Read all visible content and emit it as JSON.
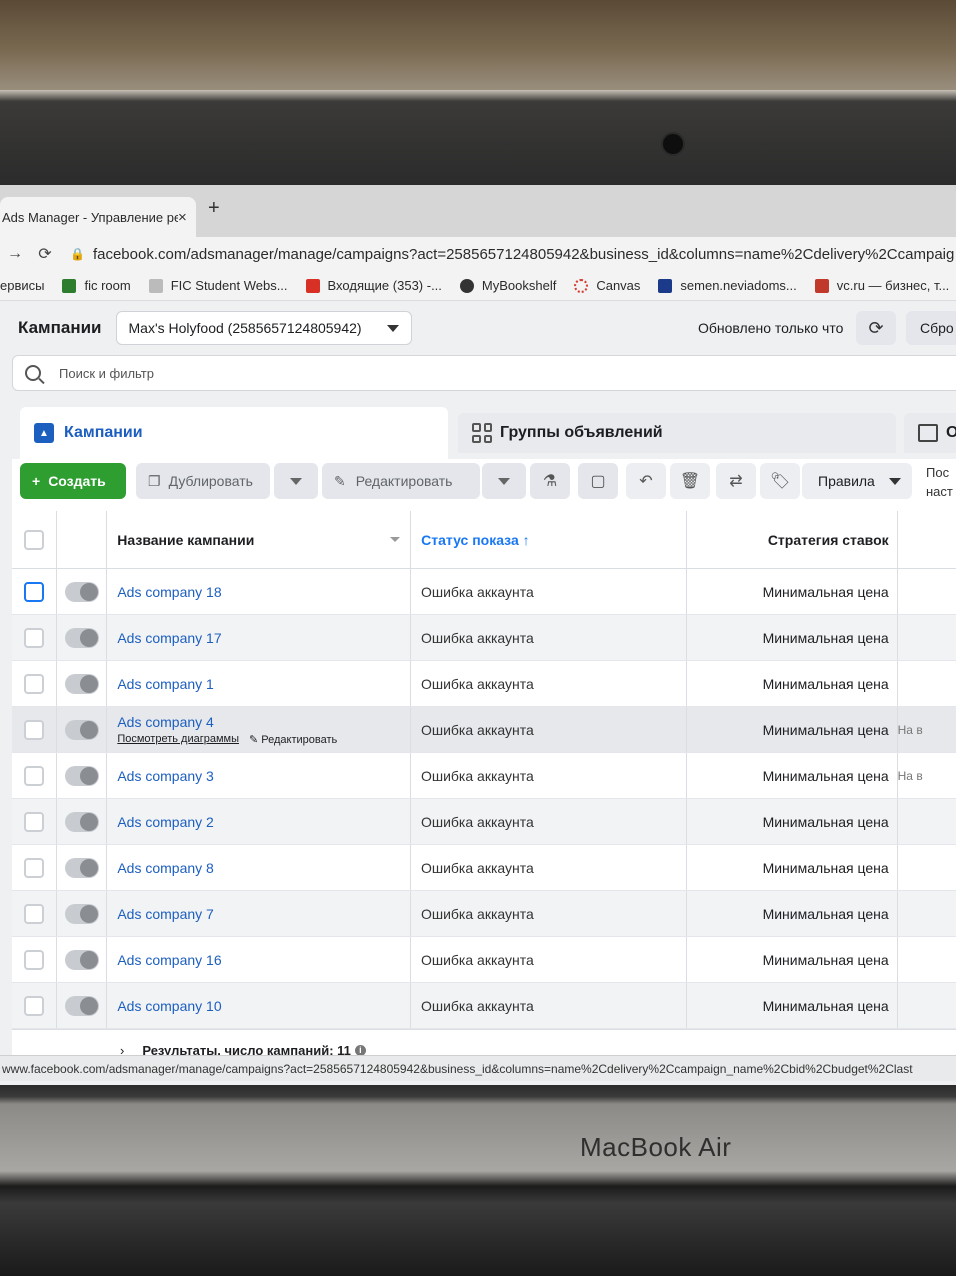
{
  "browser": {
    "tab_title": "Ads Manager - Управление ре",
    "tab_close": "×",
    "new_tab": "+",
    "url": "facebook.com/adsmanager/manage/campaigns?act=2585657124805942&business_id&columns=name%2Cdelivery%2Ccampaig",
    "bookmarks": [
      "ервисы",
      "fic room",
      "FIC Student Webs...",
      "Входящие (353) -...",
      "MyBookshelf",
      "Canvas",
      "semen.neviadoms...",
      "vc.ru — бизнес, т..."
    ],
    "status_url": "www.facebook.com/adsmanager/manage/campaigns?act=2585657124805942&business_id&columns=name%2Cdelivery%2Ccampaign_name%2Cbid%2Cbudget%2Clast"
  },
  "header": {
    "title": "Кампании",
    "account": "Max's Holyfood (2585657124805942)",
    "updated": "Обновлено только что",
    "reset": "Сбро"
  },
  "search": {
    "placeholder": "Поиск и фильтр"
  },
  "level_tabs": {
    "campaigns": "Кампании",
    "adsets": "Группы объявлений",
    "ads": "О"
  },
  "toolbar": {
    "create": "Создать",
    "duplicate": "Дублировать",
    "edit": "Редактировать",
    "rules": "Правила",
    "right_line1": "Пос",
    "right_line2": "наст"
  },
  "table": {
    "columns": {
      "name": "Название кампании",
      "status": "Статус показа ↑",
      "bid": "Стратегия ставок"
    },
    "rows": [
      {
        "name": "Ads company 18",
        "status": "Ошибка аккаунта",
        "bid": "Минимальная цена",
        "extra": ""
      },
      {
        "name": "Ads company 17",
        "status": "Ошибка аккаунта",
        "bid": "Минимальная цена",
        "extra": ""
      },
      {
        "name": "Ads company 1",
        "status": "Ошибка аккаунта",
        "bid": "Минимальная цена",
        "extra": ""
      },
      {
        "name": "Ads company 4",
        "status": "Ошибка аккаунта",
        "bid": "Минимальная цена",
        "extra": "На в"
      },
      {
        "name": "Ads company 3",
        "status": "Ошибка аккаунта",
        "bid": "Минимальная цена",
        "extra": "На в"
      },
      {
        "name": "Ads company 2",
        "status": "Ошибка аккаунта",
        "bid": "Минимальная цена",
        "extra": ""
      },
      {
        "name": "Ads company 8",
        "status": "Ошибка аккаунта",
        "bid": "Минимальная цена",
        "extra": ""
      },
      {
        "name": "Ads company 7",
        "status": "Ошибка аккаунта",
        "bid": "Минимальная цена",
        "extra": ""
      },
      {
        "name": "Ads company 16",
        "status": "Ошибка аккаунта",
        "bid": "Минимальная цена",
        "extra": ""
      },
      {
        "name": "Ads company 10",
        "status": "Ошибка аккаунта",
        "bid": "Минимальная цена",
        "extra": ""
      }
    ],
    "row_actions": {
      "view_charts": "Посмотреть диаграммы",
      "edit": "Редактировать"
    },
    "footer": "Результаты, число кампаний: 11"
  },
  "device": {
    "brand": "MacBook Air"
  },
  "colors": {
    "accent": "#1877f2",
    "create": "#2e9e31"
  }
}
